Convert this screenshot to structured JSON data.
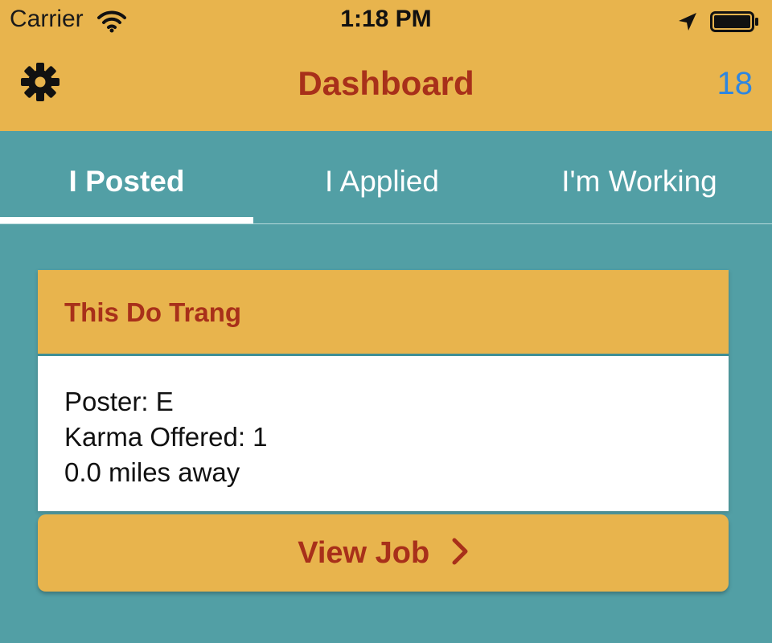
{
  "status_bar": {
    "carrier": "Carrier",
    "time": "1:18 PM",
    "icons": [
      "wifi-icon",
      "location-arrow-icon",
      "battery-icon"
    ]
  },
  "nav": {
    "title": "Dashboard",
    "settings_icon": "gear-icon",
    "count": "18"
  },
  "tabs": [
    {
      "label": "I Posted",
      "active": true
    },
    {
      "label": "I Applied",
      "active": false
    },
    {
      "label": "I'm Working",
      "active": false
    }
  ],
  "job_card": {
    "title": "This Do Trang",
    "poster": "Poster:  E",
    "karma": "Karma Offered: 1",
    "distance": "0.0 miles away",
    "button_label": "View Job",
    "button_icon": "chevron-right-icon"
  },
  "colors": {
    "header_bg": "#e8b44d",
    "title_red": "#a8301a",
    "teal_bg": "#529fa5",
    "link_blue": "#2e86e0"
  }
}
